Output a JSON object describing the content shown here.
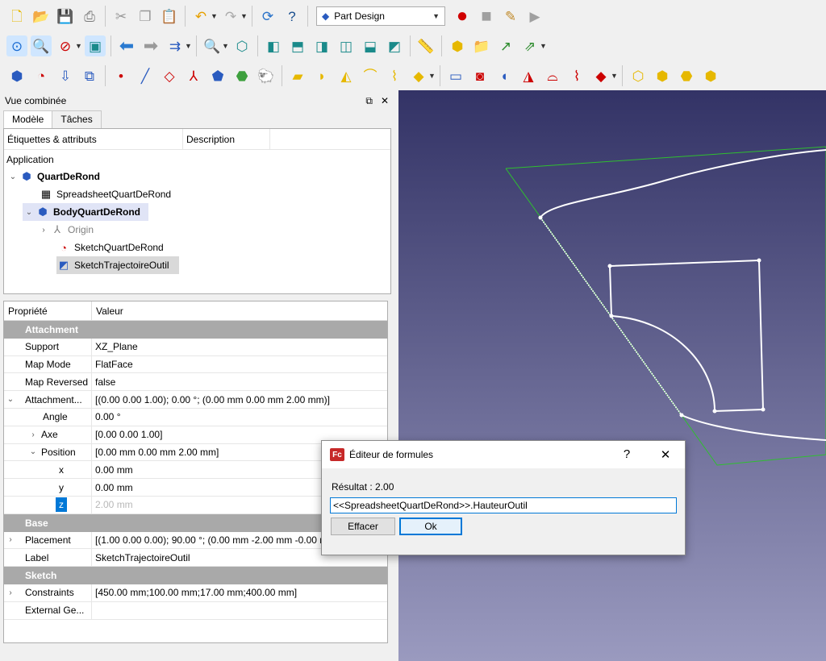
{
  "toolbar": {
    "workbench": "Part Design"
  },
  "dock": {
    "title": "Vue combinée",
    "tabs": [
      "Modèle",
      "Tâches"
    ]
  },
  "tree": {
    "col_labels": "Étiquettes & attributs",
    "col_description": "Description",
    "root": "Application",
    "items": [
      {
        "label": "QuartDeRond",
        "bold": true
      },
      {
        "label": "SpreadsheetQuartDeRond"
      },
      {
        "label": "BodyQuartDeRond",
        "bold": true
      },
      {
        "label": "Origin"
      },
      {
        "label": "SketchQuartDeRond"
      },
      {
        "label": "SketchTrajectoireOutil"
      }
    ]
  },
  "properties": {
    "col_property": "Propriété",
    "col_value": "Valeur",
    "group_attachment": "Attachment",
    "group_base": "Base",
    "group_sketch": "Sketch",
    "rows": [
      {
        "key": "Support",
        "value": "XZ_Plane"
      },
      {
        "key": "Map Mode",
        "value": "FlatFace"
      },
      {
        "key": "Map Reversed",
        "value": "false"
      },
      {
        "key": "Attachment...",
        "value": "[(0.00 0.00 1.00); 0.00 °; (0.00 mm  0.00 mm  2.00 mm)]"
      },
      {
        "key": "Angle",
        "value": "0.00 °"
      },
      {
        "key": "Axe",
        "value": "[0.00 0.00 1.00]"
      },
      {
        "key": "Position",
        "value": "[0.00 mm  0.00 mm  2.00 mm]"
      },
      {
        "key": "x",
        "value": "0.00 mm"
      },
      {
        "key": "y",
        "value": "0.00 mm"
      },
      {
        "key": "z",
        "value": "2.00 mm"
      },
      {
        "key": "Placement",
        "value": "[(1.00 0.00 0.00); 90.00 °; (0.00 mm  -2.00 mm  -0.00 mm)]"
      },
      {
        "key": "Label",
        "value": "SketchTrajectoireOutil"
      },
      {
        "key": "Constraints",
        "value": "[450.00 mm;100.00 mm;17.00 mm;400.00 mm]"
      },
      {
        "key": "External Ge...",
        "value": ""
      }
    ]
  },
  "dialog": {
    "title": "Éditeur de formules",
    "help": "?",
    "close": "✕",
    "result": "Résultat : 2.00",
    "expression": "<<SpreadsheetQuartDeRond>>.HauteurOutil",
    "clear": "Effacer",
    "ok": "Ok"
  }
}
